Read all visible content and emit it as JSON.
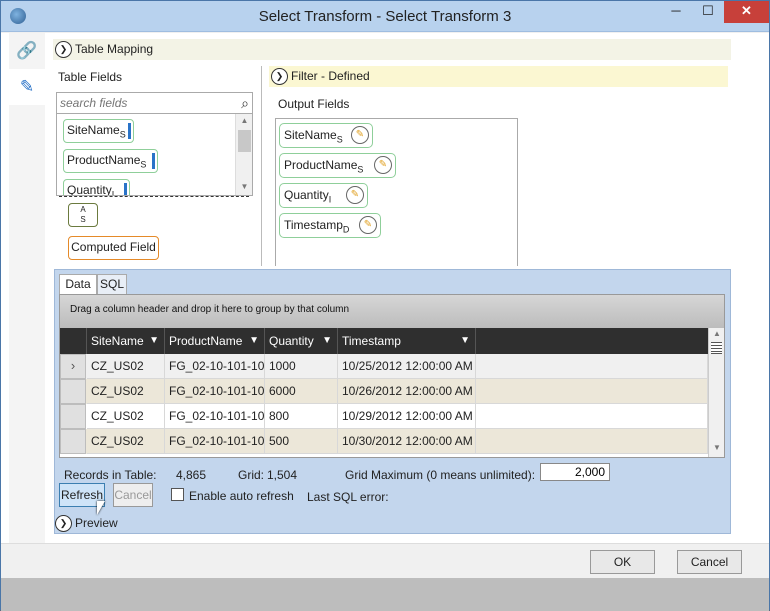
{
  "window": {
    "title": "Select Transform - Select Transform 3",
    "min": "─",
    "max": "☐",
    "close": "✕"
  },
  "sidetabs": {
    "link_icon": "🔗",
    "edit_icon": "✎"
  },
  "table_mapping": {
    "header": "Table Mapping",
    "table_fields_label": "Table Fields",
    "search_placeholder": "search fields",
    "fields": [
      {
        "name": "SiteName",
        "type": "S"
      },
      {
        "name": "ProductName",
        "type": "S"
      },
      {
        "name": "Quantity",
        "type": "I"
      }
    ],
    "as_chip": {
      "top": "A",
      "bottom": "S"
    },
    "computed_field": "Computed Field"
  },
  "filter": {
    "header": "Filter - Defined",
    "output_fields_label": "Output Fields",
    "fields": [
      {
        "name": "SiteName",
        "type": "S"
      },
      {
        "name": "ProductName",
        "type": "S"
      },
      {
        "name": "Quantity",
        "type": "I"
      },
      {
        "name": "Timestamp",
        "type": "D"
      }
    ]
  },
  "tabs": {
    "data": "Data",
    "sql": "SQL"
  },
  "grid": {
    "group_hint": "Drag a column header and drop it here to group by that column",
    "columns": [
      "SiteName",
      "ProductName",
      "Quantity",
      "Timestamp"
    ],
    "rows": [
      [
        "CZ_US02",
        "FG_02-10-101-10",
        "1000",
        "10/25/2012 12:00:00 AM"
      ],
      [
        "CZ_US02",
        "FG_02-10-101-10",
        "6000",
        "10/26/2012 12:00:00 AM"
      ],
      [
        "CZ_US02",
        "FG_02-10-101-10",
        "800",
        "10/29/2012 12:00:00 AM"
      ],
      [
        "CZ_US02",
        "FG_02-10-101-10",
        "500",
        "10/30/2012 12:00:00 AM"
      ]
    ]
  },
  "stats": {
    "records_label": "Records in Table:",
    "records_value": "4,865",
    "grid_label": "Grid:",
    "grid_value": "1,504",
    "grid_max_label": "Grid Maximum (0 means unlimited):",
    "grid_max_value": "2,000"
  },
  "actions": {
    "refresh": "Refresh",
    "cancel": "Cancel",
    "auto_refresh": "Enable auto refresh",
    "last_sql_error": "Last SQL error:"
  },
  "preview": {
    "header": "Preview"
  },
  "footer": {
    "ok": "OK",
    "cancel": "Cancel"
  }
}
